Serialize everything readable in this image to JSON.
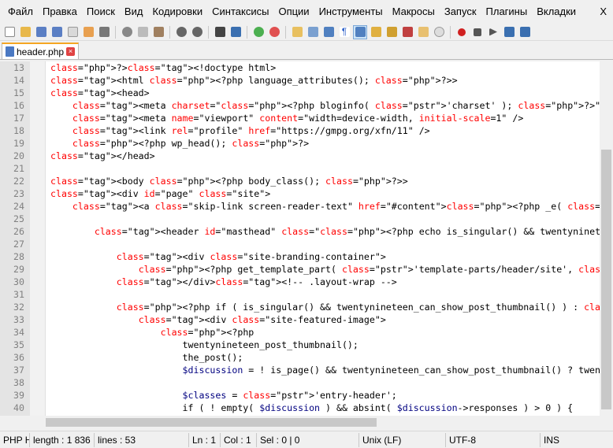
{
  "menu": {
    "items": [
      "Файл",
      "Правка",
      "Поиск",
      "Вид",
      "Кодировки",
      "Синтаксисы",
      "Опции",
      "Инструменты",
      "Макросы",
      "Запуск",
      "Плагины",
      "Вкладки"
    ],
    "close": "X"
  },
  "tab": {
    "label": "header.php"
  },
  "code_lines": [
    {
      "n": "13",
      "text": "?><!doctype html>"
    },
    {
      "n": "14",
      "text": "<html <?php language_attributes(); ?>>"
    },
    {
      "n": "15",
      "text": "<head>"
    },
    {
      "n": "16",
      "text": "    <meta charset=\"<?php bloginfo( 'charset' ); ?>\" />"
    },
    {
      "n": "17",
      "text": "    <meta name=\"viewport\" content=\"width=device-width, initial-scale=1\" />"
    },
    {
      "n": "18",
      "text": "    <link rel=\"profile\" href=\"https://gmpg.org/xfn/11\" />"
    },
    {
      "n": "19",
      "text": "    <?php wp_head(); ?>"
    },
    {
      "n": "20",
      "text": "</head>"
    },
    {
      "n": "21",
      "text": ""
    },
    {
      "n": "22",
      "text": "<body <?php body_class(); ?>>"
    },
    {
      "n": "23",
      "text": "<div id=\"page\" class=\"site\">"
    },
    {
      "n": "24",
      "text": "    <a class=\"skip-link screen-reader-text\" href=\"#content\"><?php _e( 'Skip to content', 'twentynine"
    },
    {
      "n": "25",
      "text": ""
    },
    {
      "n": "26",
      "text": "        <header id=\"masthead\" class=\"<?php echo is_singular() && twentynineteen_can_show_post_thumbna"
    },
    {
      "n": "27",
      "text": ""
    },
    {
      "n": "28",
      "text": "            <div class=\"site-branding-container\">"
    },
    {
      "n": "29",
      "text": "                <?php get_template_part( 'template-parts/header/site', 'branding' ); ?>"
    },
    {
      "n": "30",
      "text": "            </div><!-- .layout-wrap -->"
    },
    {
      "n": "31",
      "text": ""
    },
    {
      "n": "32",
      "text": "            <?php if ( is_singular() && twentynineteen_can_show_post_thumbnail() ) : ?>"
    },
    {
      "n": "33",
      "text": "                <div class=\"site-featured-image\">"
    },
    {
      "n": "34",
      "text": "                    <?php"
    },
    {
      "n": "35",
      "text": "                        twentynineteen_post_thumbnail();"
    },
    {
      "n": "36",
      "text": "                        the_post();"
    },
    {
      "n": "37",
      "text": "                        $discussion = ! is_page() && twentynineteen_can_show_post_thumbnail() ? twentynin"
    },
    {
      "n": "38",
      "text": ""
    },
    {
      "n": "39",
      "text": "                        $classes = 'entry-header';"
    },
    {
      "n": "40",
      "text": "                        if ( ! empty( $discussion ) && absint( $discussion->responses ) > 0 ) {"
    }
  ],
  "status": {
    "lang": "PHP H",
    "length": "length : 1 836",
    "lines": "lines : 53",
    "ln": "Ln : 1",
    "col": "Col : 1",
    "sel": "Sel : 0 | 0",
    "eol": "Unix (LF)",
    "enc": "UTF-8",
    "mode": "INS"
  }
}
